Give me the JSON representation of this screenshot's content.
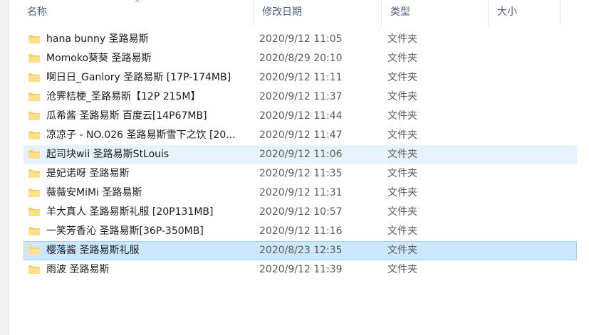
{
  "columns": {
    "name": "名称",
    "date": "修改日期",
    "type": "类型",
    "size": "大小"
  },
  "sort_indicator": "^",
  "files": [
    {
      "name": "hana bunny 圣路易斯",
      "date": "2020/9/12 11:05",
      "type": "文件夹"
    },
    {
      "name": "Momoko葵葵 圣路易斯",
      "date": "2020/8/29 20:10",
      "type": "文件夹"
    },
    {
      "name": "啊日日_Ganlory 圣路易斯 [17P-174MB]",
      "date": "2020/9/12 11:11",
      "type": "文件夹"
    },
    {
      "name": "沧霁桔梗_圣路易斯【12P 215M】",
      "date": "2020/9/12 11:37",
      "type": "文件夹"
    },
    {
      "name": "瓜希酱 圣路易斯 百度云[14P67MB]",
      "date": "2020/9/12 11:44",
      "type": "文件夹"
    },
    {
      "name": "凉凉子 - NO.026 圣路易斯雪下之饮 [20...",
      "date": "2020/9/12 11:47",
      "type": "文件夹"
    },
    {
      "name": "起司块wii 圣路易斯StLouis",
      "date": "2020/9/12 11:06",
      "type": "文件夹"
    },
    {
      "name": "是妃诺呀 圣路易斯",
      "date": "2020/9/12 11:35",
      "type": "文件夹"
    },
    {
      "name": "薇薇安MiMi 圣路易斯",
      "date": "2020/9/12 11:31",
      "type": "文件夹"
    },
    {
      "name": "羊大真人 圣路易斯礼服 [20P131MB]",
      "date": "2020/9/12 10:57",
      "type": "文件夹"
    },
    {
      "name": "一笑芳香沁 圣路易斯[36P-350MB]",
      "date": "2020/9/12 11:16",
      "type": "文件夹"
    },
    {
      "name": "樱落酱 圣路易斯礼服",
      "date": "2020/8/23 12:35",
      "type": "文件夹"
    },
    {
      "name": "雨波 圣路易斯",
      "date": "2020/9/12 11:39",
      "type": "文件夹"
    }
  ],
  "colors": {
    "hover_row": "#e5f3ff",
    "selected_row": "#cce8ff",
    "selected_border": "#99d1ff",
    "folder": "#f8d775",
    "header_text": "#4c607a"
  }
}
